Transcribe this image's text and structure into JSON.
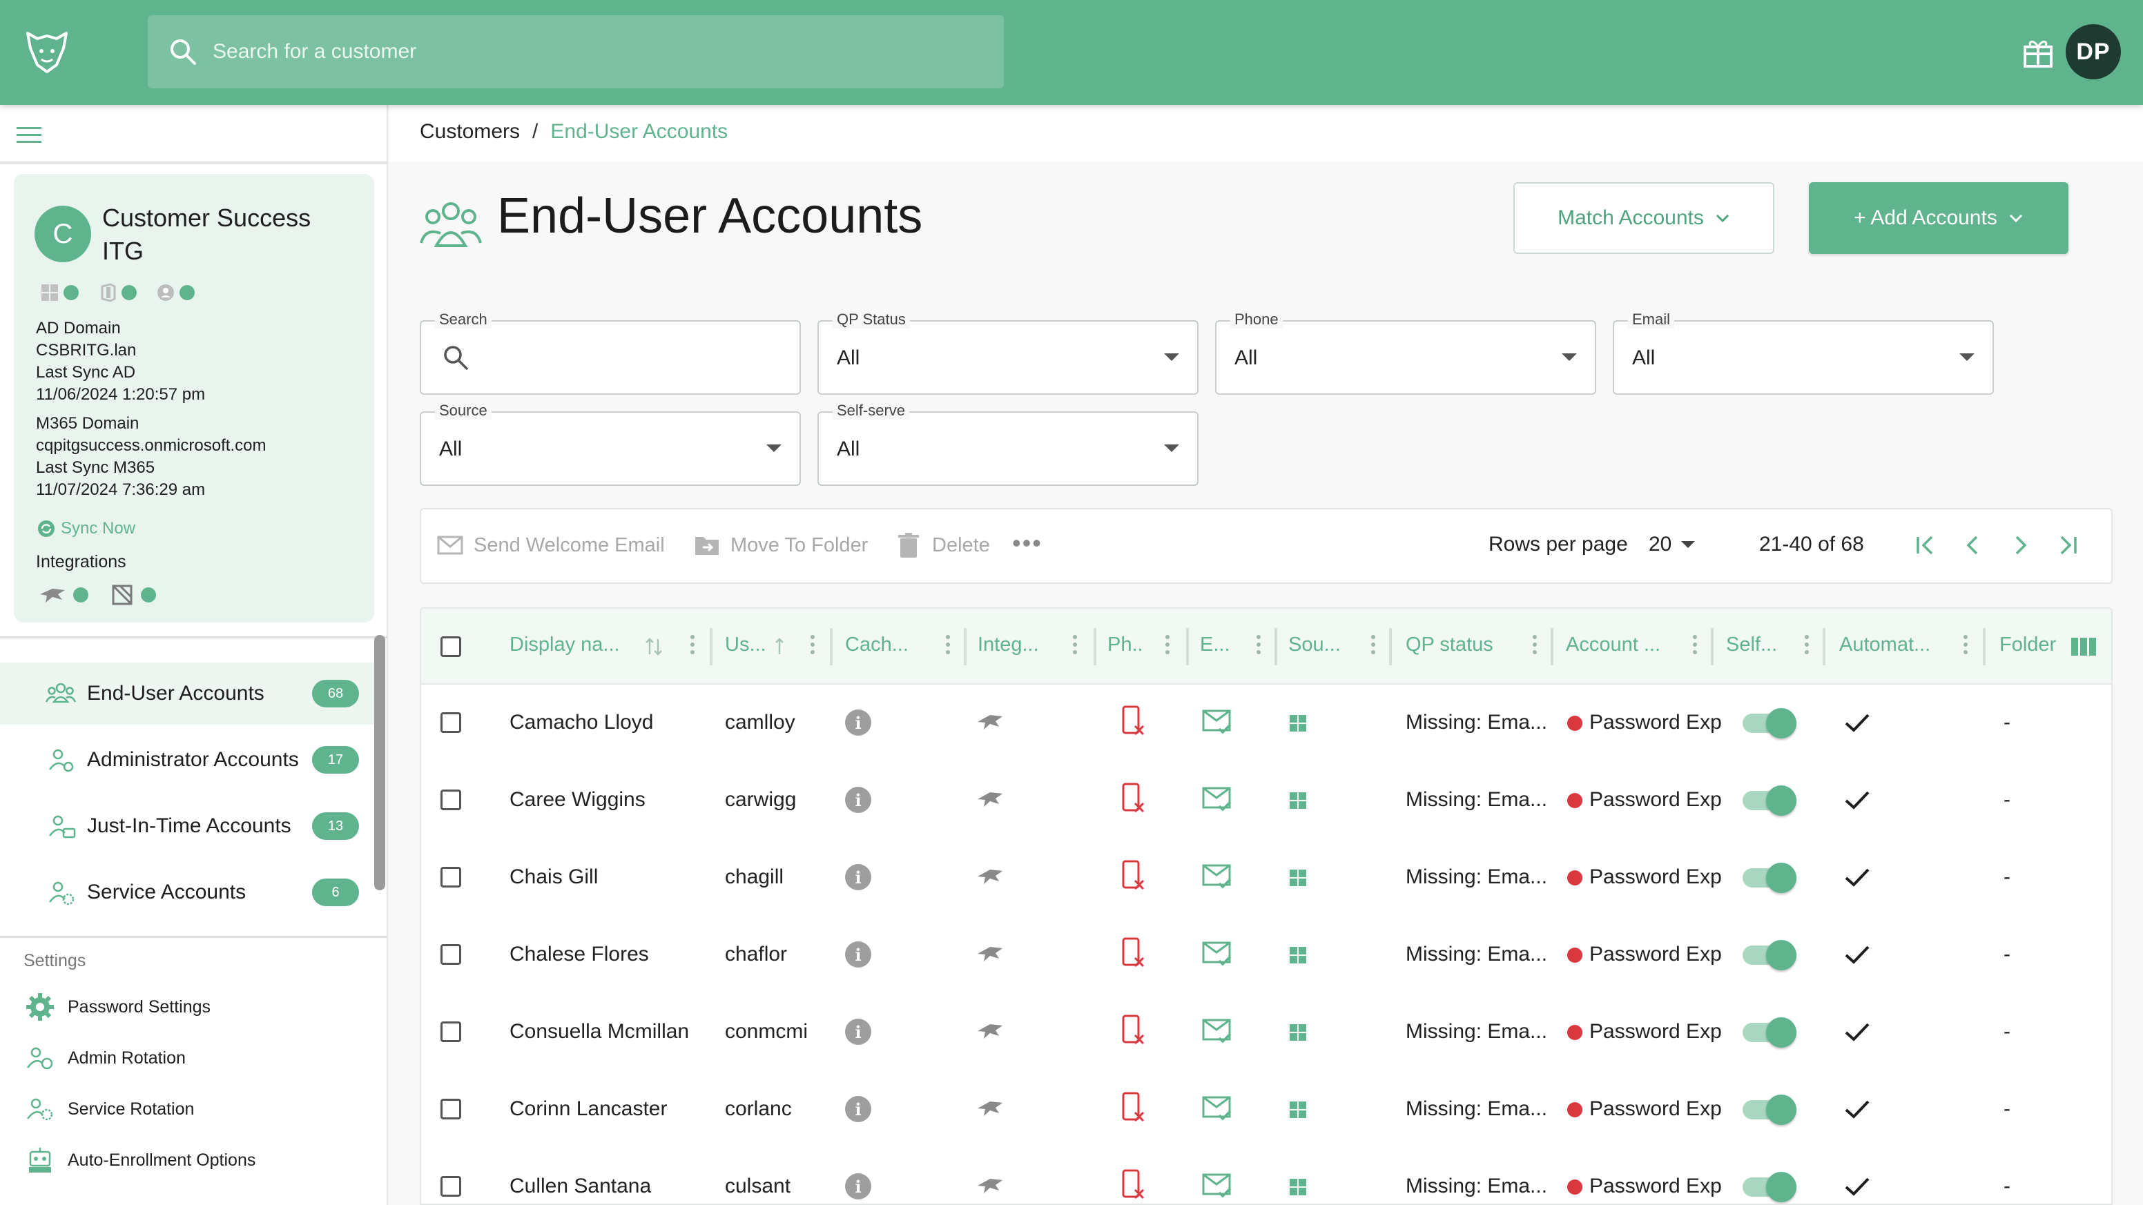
{
  "topbar": {
    "search_placeholder": "Search for a customer",
    "user_initials": "DP",
    "accent": "#5fb48e"
  },
  "customer": {
    "initial": "C",
    "name": "Customer Success ITG",
    "ad_domain_label": "AD Domain",
    "ad_domain": "CSBRITG.lan",
    "last_sync_ad_label": "Last Sync AD",
    "last_sync_ad": "11/06/2024 1:20:57 pm",
    "m365_domain_label": "M365 Domain",
    "m365_domain": "cqpitgsuccess.onmicrosoft.com",
    "last_sync_m365_label": "Last Sync M365",
    "last_sync_m365": "11/07/2024 7:36:29 am",
    "sync_now": "Sync Now",
    "integrations_label": "Integrations"
  },
  "nav": {
    "items": [
      {
        "label": "End-User Accounts",
        "badge": "68",
        "icon": "users-icon"
      },
      {
        "label": "Administrator Accounts",
        "badge": "17",
        "icon": "admin-users-icon"
      },
      {
        "label": "Just-In-Time Accounts",
        "badge": "13",
        "icon": "jit-users-icon"
      },
      {
        "label": "Service Accounts",
        "badge": "6",
        "icon": "service-users-icon"
      }
    ]
  },
  "settings": {
    "label": "Settings",
    "items": [
      {
        "label": "Password Settings",
        "icon": "gear-icon"
      },
      {
        "label": "Admin Rotation",
        "icon": "admin-rotation-icon"
      },
      {
        "label": "Service Rotation",
        "icon": "service-rotation-icon"
      },
      {
        "label": "Auto-Enrollment Options",
        "icon": "robot-icon"
      }
    ]
  },
  "breadcrumb": {
    "root": "Customers",
    "separator": "/",
    "current": "End-User Accounts"
  },
  "page": {
    "title": "End-User Accounts",
    "match_button": "Match Accounts",
    "add_button": "+ Add Accounts"
  },
  "filters": {
    "search": {
      "label": "Search",
      "value": ""
    },
    "qp_status": {
      "label": "QP Status",
      "value": "All"
    },
    "phone": {
      "label": "Phone",
      "value": "All"
    },
    "email": {
      "label": "Email",
      "value": "All"
    },
    "source": {
      "label": "Source",
      "value": "All"
    },
    "self_serve": {
      "label": "Self-serve",
      "value": "All"
    }
  },
  "toolbar": {
    "send_welcome": "Send Welcome Email",
    "move_folder": "Move To Folder",
    "delete": "Delete",
    "rows_per_page_label": "Rows per page",
    "rows_per_page": "20",
    "range": "21-40 of 68"
  },
  "table": {
    "columns": [
      "Display na...",
      "Us...",
      "Cach...",
      "Integ...",
      "Ph..",
      "E...",
      "Sou...",
      "QP status",
      "Account ...",
      "Self...",
      "Automat...",
      "Folder"
    ],
    "rows": [
      {
        "display_name": "Camacho Lloyd",
        "username": "camlloy",
        "qp_status": "Missing: Ema...",
        "account": "Password Exp",
        "folder": "-"
      },
      {
        "display_name": "Caree Wiggins",
        "username": "carwigg",
        "qp_status": "Missing: Ema...",
        "account": "Password Exp",
        "folder": "-"
      },
      {
        "display_name": "Chais Gill",
        "username": "chagill",
        "qp_status": "Missing: Ema...",
        "account": "Password Exp",
        "folder": "-"
      },
      {
        "display_name": "Chalese Flores",
        "username": "chaflor",
        "qp_status": "Missing: Ema...",
        "account": "Password Exp",
        "folder": "-"
      },
      {
        "display_name": "Consuella Mcmillan",
        "username": "conmcmi",
        "qp_status": "Missing: Ema...",
        "account": "Password Exp",
        "folder": "-"
      },
      {
        "display_name": "Corinn Lancaster",
        "username": "corlanc",
        "qp_status": "Missing: Ema...",
        "account": "Password Exp",
        "folder": "-"
      },
      {
        "display_name": "Cullen Santana",
        "username": "culsant",
        "qp_status": "Missing: Ema...",
        "account": "Password Exp",
        "folder": "-"
      }
    ]
  }
}
